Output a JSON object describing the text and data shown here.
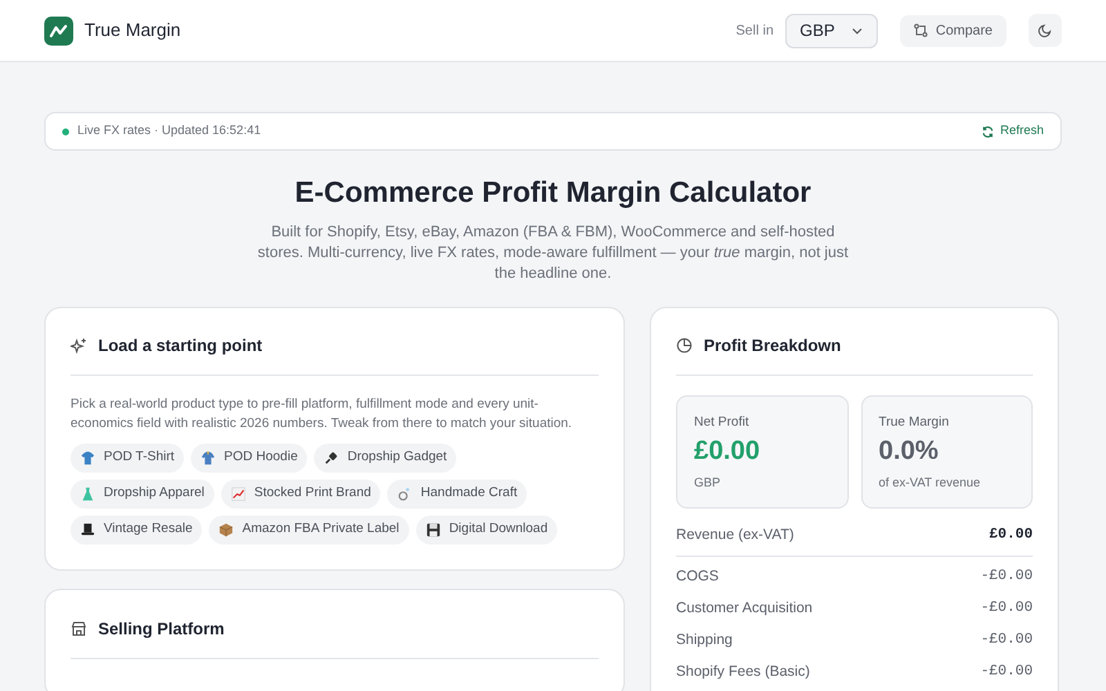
{
  "header": {
    "brand": "True Margin",
    "sell_in_label": "Sell in",
    "currency": "GBP",
    "compare_button": "Compare"
  },
  "fx_bar": {
    "live": true,
    "status": "Live FX rates · Updated 16:52:41",
    "refresh": "Refresh"
  },
  "hero": {
    "title": "E-Commerce Profit Margin Calculator",
    "subtitle": "Built for Shopify, Etsy, eBay, Amazon (FBA & FBM), WooCommerce and self-hosted stores. Multi-currency, live FX rates, mode-aware fulfillment — your *true* margin, not just the headline one."
  },
  "starting_point": {
    "title": "Load a starting point",
    "description": "Pick a real-world product type to pre-fill platform, fulfillment mode and every unit-economics field with realistic 2026 numbers. Tweak from there to match your situation.",
    "presets": [
      {
        "label": "POD T-Shirt"
      },
      {
        "label": "POD Hoodie"
      },
      {
        "label": "Dropship Gadget"
      },
      {
        "label": "Dropship Apparel"
      },
      {
        "label": "Stocked Print Brand"
      },
      {
        "label": "Handmade Craft"
      },
      {
        "label": "Vintage Resale"
      },
      {
        "label": "Amazon FBA Private Label"
      },
      {
        "label": "Digital Download"
      }
    ]
  },
  "selling_platform": {
    "title": "Selling Platform"
  },
  "profit_breakdown": {
    "title": "Profit Breakdown",
    "net_profit": {
      "label": "Net Profit",
      "value": "£0.00",
      "caption": "GBP"
    },
    "true_margin": {
      "label": "True Margin",
      "value": "0.0%",
      "caption": "of ex-VAT revenue"
    },
    "revenue": {
      "label": "Revenue (ex-VAT)",
      "value": "£0.00"
    },
    "costs": [
      {
        "label": "COGS",
        "value": "-£0.00"
      },
      {
        "label": "Customer Acquisition",
        "value": "-£0.00"
      },
      {
        "label": "Shipping",
        "value": "-£0.00"
      },
      {
        "label": "Shopify Fees (Basic)",
        "value": "-£0.00"
      }
    ]
  }
}
